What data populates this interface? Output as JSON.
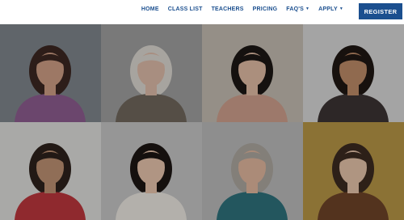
{
  "header": {
    "nav": [
      {
        "id": "home",
        "label": "HOME",
        "has_dropdown": false
      },
      {
        "id": "class-list",
        "label": "CLASS LIST",
        "has_dropdown": false
      },
      {
        "id": "teachers",
        "label": "TEACHERS",
        "has_dropdown": false
      },
      {
        "id": "pricing",
        "label": "PRICING",
        "has_dropdown": false
      },
      {
        "id": "faqs",
        "label": "FAQ'S",
        "has_dropdown": true
      },
      {
        "id": "apply",
        "label": "APPLY",
        "has_dropdown": true
      }
    ],
    "register_label": "REGISTER",
    "accent": "#1b4f8f"
  },
  "gallery": {
    "photos": [
      {
        "id": "teacher-1",
        "bg": "#7c8288",
        "skin": "#c99a82",
        "hair": "#3a2620",
        "top": "#8a5a8c"
      },
      {
        "id": "teacher-2",
        "bg": "#9b9b9b",
        "skin": "#d8b6a4",
        "hair": "#d7d3cc",
        "top": "#6d655a"
      },
      {
        "id": "teacher-3",
        "bg": "#bfb8ad",
        "skin": "#dcb8a1",
        "hair": "#1b1614",
        "top": "#c99c8a"
      },
      {
        "id": "teacher-4",
        "bg": "#d2d2d2",
        "skin": "#b98866",
        "hair": "#1e1613",
        "top": "#3a3232"
      },
      {
        "id": "teacher-5",
        "bg": "#d9d9d6",
        "skin": "#b98d70",
        "hair": "#2c211b",
        "top": "#b8353b"
      },
      {
        "id": "teacher-6",
        "bg": "#c0c0c0",
        "skin": "#e2bfa8",
        "hair": "#1c1512",
        "top": "#e6e2dc"
      },
      {
        "id": "teacher-7",
        "bg": "#b7b7b7",
        "skin": "#dcb29a",
        "hair": "#a8a39c",
        "top": "#2e6f79"
      },
      {
        "id": "teacher-8",
        "bg": "#b39345",
        "skin": "#e1bfa6",
        "hair": "#3a2a1f",
        "top": "#6b4227"
      }
    ]
  }
}
